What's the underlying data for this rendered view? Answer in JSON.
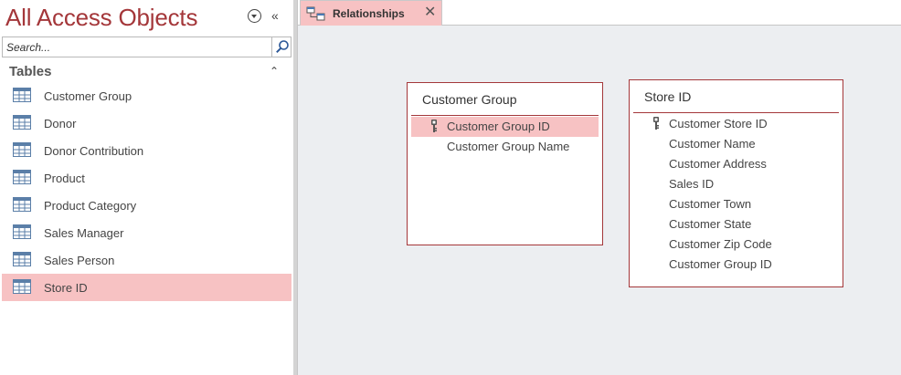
{
  "nav_pane": {
    "title": "All Access Objects",
    "menu_icon": "circle-chevron-down-icon",
    "collapse_icon": "double-chevron-left-icon",
    "collapse_symbol": "«",
    "search": {
      "placeholder": "Search...",
      "value": "",
      "icon": "search-icon"
    },
    "group": {
      "label": "Tables",
      "collapse_symbol": "⌃",
      "items": [
        {
          "label": "Customer Group",
          "icon": "table-icon",
          "selected": false
        },
        {
          "label": "Donor",
          "icon": "table-icon",
          "selected": false
        },
        {
          "label": "Donor Contribution",
          "icon": "table-icon",
          "selected": false
        },
        {
          "label": "Product",
          "icon": "table-icon",
          "selected": false
        },
        {
          "label": "Product Category",
          "icon": "table-icon",
          "selected": false
        },
        {
          "label": "Sales Manager",
          "icon": "table-icon",
          "selected": false
        },
        {
          "label": "Sales Person",
          "icon": "table-icon",
          "selected": false
        },
        {
          "label": "Store ID",
          "icon": "table-icon",
          "selected": true
        }
      ]
    }
  },
  "document": {
    "tab": {
      "label": "Relationships",
      "icon": "relationships-icon",
      "close_symbol": "✕"
    },
    "field_lists": [
      {
        "title": "Customer Group",
        "fields": [
          {
            "label": "Customer Group ID",
            "primary_key": true,
            "selected": true
          },
          {
            "label": "Customer Group Name",
            "primary_key": false,
            "selected": false
          }
        ]
      },
      {
        "title": "Store ID",
        "fields": [
          {
            "label": "Customer Store ID",
            "primary_key": true,
            "selected": false
          },
          {
            "label": "Customer Name",
            "primary_key": false,
            "selected": false
          },
          {
            "label": "Customer Address",
            "primary_key": false,
            "selected": false
          },
          {
            "label": "Sales ID",
            "primary_key": false,
            "selected": false
          },
          {
            "label": "Customer Town",
            "primary_key": false,
            "selected": false
          },
          {
            "label": "Customer State",
            "primary_key": false,
            "selected": false
          },
          {
            "label": "Customer Zip Code",
            "primary_key": false,
            "selected": false
          },
          {
            "label": "Customer Group ID",
            "primary_key": false,
            "selected": false
          }
        ]
      }
    ]
  },
  "colors": {
    "accent": "#a4373a",
    "selection": "#f7c2c3",
    "canvas": "#eceef1"
  }
}
